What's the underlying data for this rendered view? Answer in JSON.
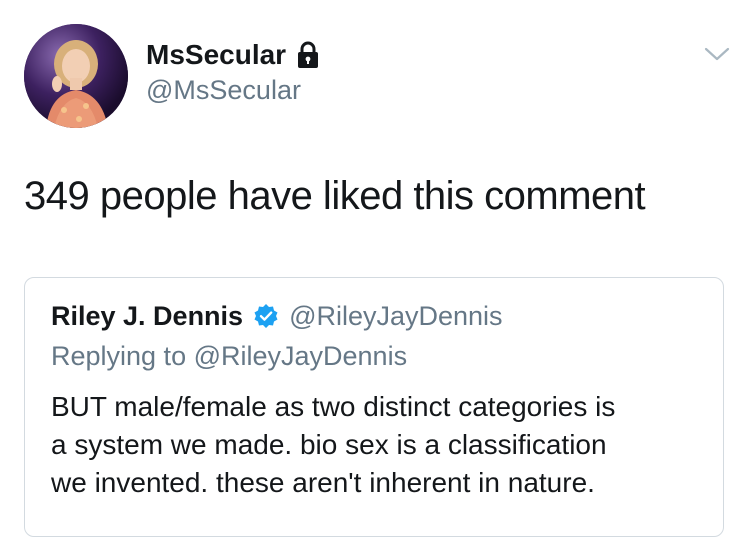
{
  "tweet": {
    "author_name": "MsSecular",
    "author_handle": "@MsSecular",
    "text": "349 people have liked this comment"
  },
  "quoted_tweet": {
    "author_name": "Riley J. Dennis",
    "author_handle": "@RileyJayDennis",
    "replying_to": "Replying to @RileyJayDennis",
    "body_lines": [
      "BUT male/female as two distinct categories is",
      "a system we made. bio sex is a classification",
      "we invented. these aren't inherent in nature."
    ]
  },
  "icons": {
    "lock": "lock-icon",
    "verified": "verified-badge-icon",
    "menu": "chevron-down-icon"
  },
  "colors": {
    "verified": "#1da1f2",
    "secondary_text": "#657786",
    "primary_text": "#14171a",
    "card_border": "#d3dae0"
  }
}
